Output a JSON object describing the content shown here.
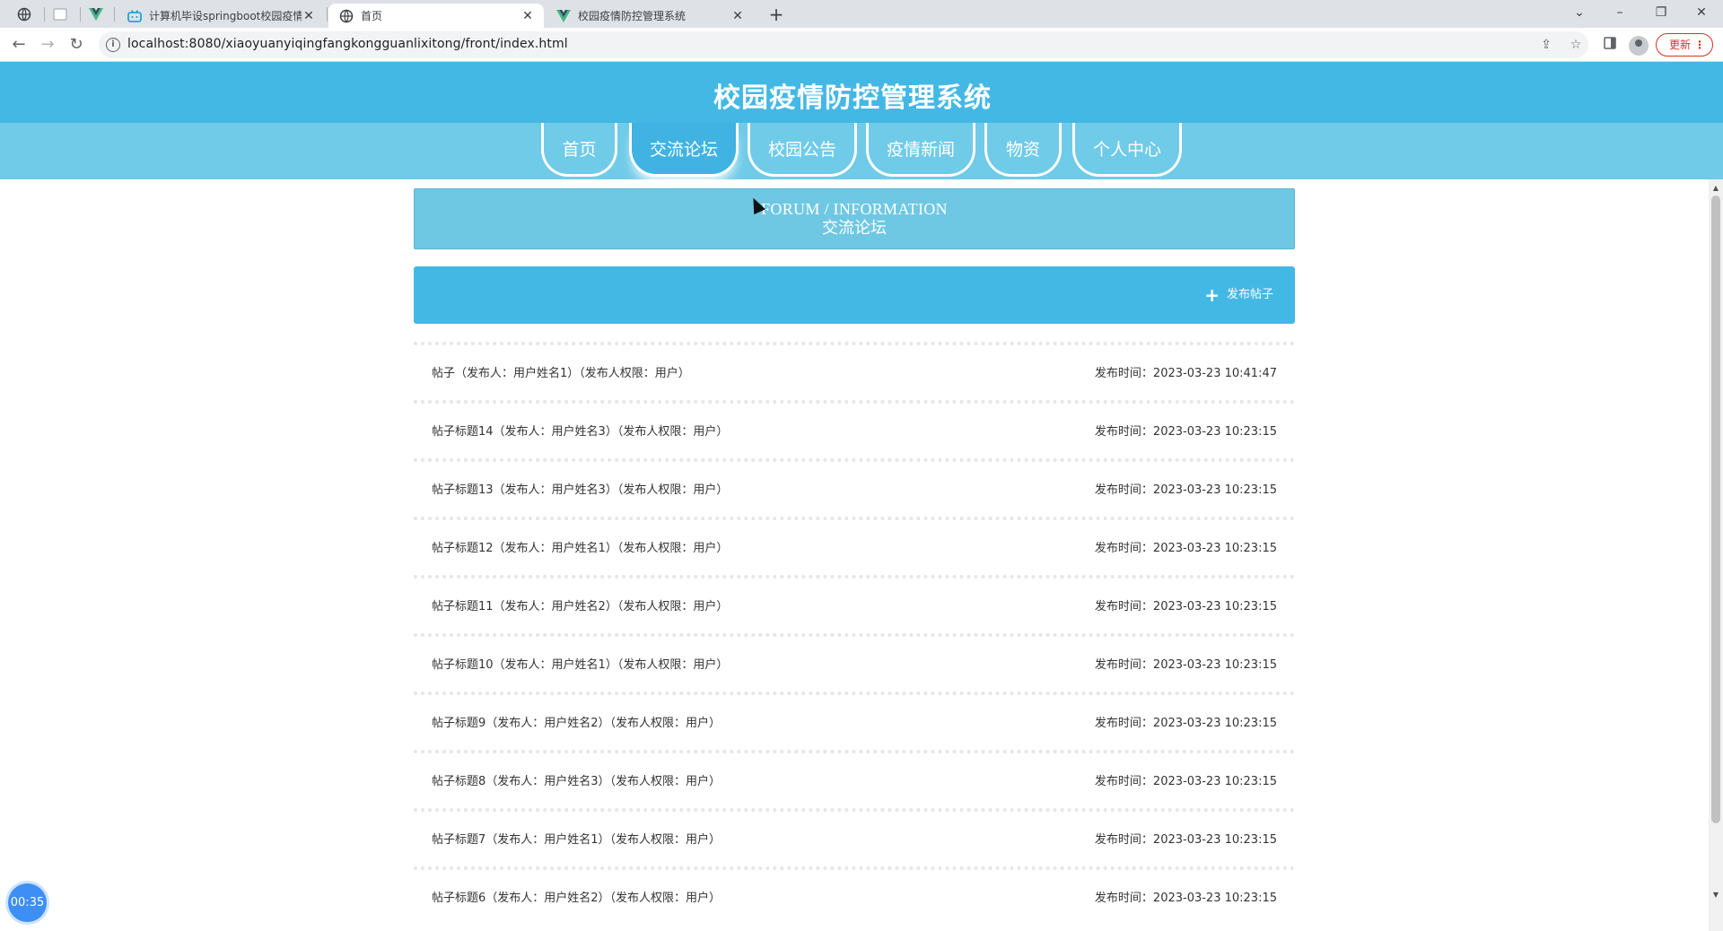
{
  "browser": {
    "tabs": [
      {
        "title": "计算机毕设springboot校园疫情",
        "active": false
      },
      {
        "title": "首页",
        "active": true
      },
      {
        "title": "校园疫情防控管理系统",
        "active": false
      }
    ],
    "new_tab": "+",
    "url": "localhost:8080/xiaoyuanyiqingfangkongguanlixitong/front/index.html",
    "update_label": "更新",
    "update_menu": "⋮"
  },
  "site": {
    "title": "校园疫情防控管理系统",
    "nav": [
      "首页",
      "交流论坛",
      "校园公告",
      "疫情新闻",
      "物资",
      "个人中心"
    ],
    "active_nav": "交流论坛"
  },
  "banner": {
    "en": "FORUM / INFORMATION",
    "cn": "交流论坛"
  },
  "action": {
    "post_label": "发布帖子",
    "plus": "+"
  },
  "posts": [
    {
      "title": "帖子（发布人：用户姓名1）（发布人权限：用户）",
      "time": "发布时间：2023-03-23 10:41:47"
    },
    {
      "title": "帖子标题14（发布人：用户姓名3）（发布人权限：用户）",
      "time": "发布时间：2023-03-23 10:23:15"
    },
    {
      "title": "帖子标题13（发布人：用户姓名3）（发布人权限：用户）",
      "time": "发布时间：2023-03-23 10:23:15"
    },
    {
      "title": "帖子标题12（发布人：用户姓名1）（发布人权限：用户）",
      "time": "发布时间：2023-03-23 10:23:15"
    },
    {
      "title": "帖子标题11（发布人：用户姓名2）（发布人权限：用户）",
      "time": "发布时间：2023-03-23 10:23:15"
    },
    {
      "title": "帖子标题10（发布人：用户姓名1）（发布人权限：用户）",
      "time": "发布时间：2023-03-23 10:23:15"
    },
    {
      "title": "帖子标题9（发布人：用户姓名2）（发布人权限：用户）",
      "time": "发布时间：2023-03-23 10:23:15"
    },
    {
      "title": "帖子标题8（发布人：用户姓名3）（发布人权限：用户）",
      "time": "发布时间：2023-03-23 10:23:15"
    },
    {
      "title": "帖子标题7（发布人：用户姓名1）（发布人权限：用户）",
      "time": "发布时间：2023-03-23 10:23:15"
    },
    {
      "title": "帖子标题6（发布人：用户姓名2）（发布人权限：用户）",
      "time": "发布时间：2023-03-23 10:23:15"
    }
  ],
  "timer": "00:35",
  "colors": {
    "header": "#44b8e4",
    "navbar": "#6fcbe8",
    "banner": "#6fc8e3",
    "action_bar": "#44b8e4",
    "timer": "#3d8ff5",
    "update_red": "#d93025"
  }
}
